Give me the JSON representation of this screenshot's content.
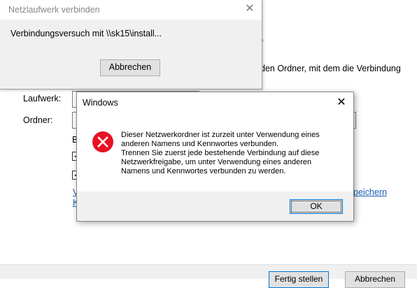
{
  "wizard": {
    "question_fragment": "?",
    "description": "den Ordner, mit dem die Verbindung",
    "drive_label": "Laufwerk:",
    "folder_label": "Ordner:",
    "browse_letter": "B",
    "link_left_1": "V",
    "link_left_2": "K",
    "link_right": "peichern",
    "finish_button": "Fertig stellen",
    "cancel_button": "Abbrechen"
  },
  "progress_dialog": {
    "title": "Netzlaufwerk verbinden",
    "message": "Verbindungsversuch mit \\\\sk15\\install...",
    "cancel_button": "Abbrechen"
  },
  "error_dialog": {
    "title": "Windows",
    "icon": "error-icon",
    "message_lines": [
      "Dieser Netzwerkordner ist zurzeit unter Verwendung eines",
      "anderen Namens und Kennwortes verbunden.",
      "Trennen Sie zuerst jede bestehende Verbindung auf diese",
      "Netzwerkfreigabe, um unter Verwendung eines anderen",
      "Namens und Kennwortes verbunden zu werden."
    ],
    "ok_button": "OK"
  },
  "colors": {
    "error_red": "#e81123",
    "link_blue": "#1a5fb4",
    "focus_blue": "#0078d7"
  }
}
